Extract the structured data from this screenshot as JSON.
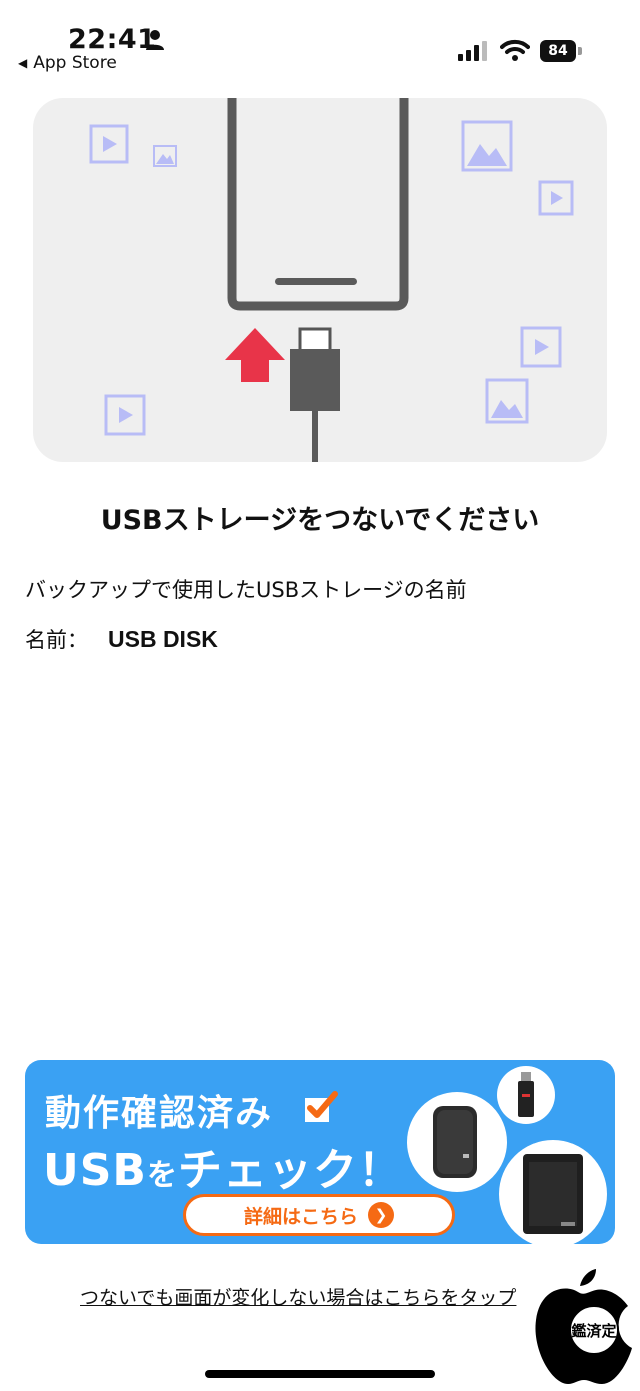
{
  "status_bar": {
    "time": "22:41",
    "back_label": "App Store",
    "battery_level": "84"
  },
  "illustration": {
    "icons": [
      "video-icon",
      "image-icon",
      "usb-cable-icon",
      "phone-icon",
      "up-arrow-icon"
    ]
  },
  "main": {
    "heading": "USBストレージをつないでください",
    "description": "バックアップで使用したUSBストレージの名前",
    "name_label": "名前：",
    "name_value": "USB DISK"
  },
  "banner": {
    "line1": "動作確認済み",
    "line2_a": "USB",
    "line2_b": "を",
    "line2_c": "チェック！",
    "button_label": "詳細はこちら",
    "colors": {
      "background": "#3aa1f3",
      "accent": "#f56a14"
    }
  },
  "footer": {
    "help_link": "つないでも画面が変化しない場合はこちらをタップ",
    "badge_text": "鑑済定"
  }
}
